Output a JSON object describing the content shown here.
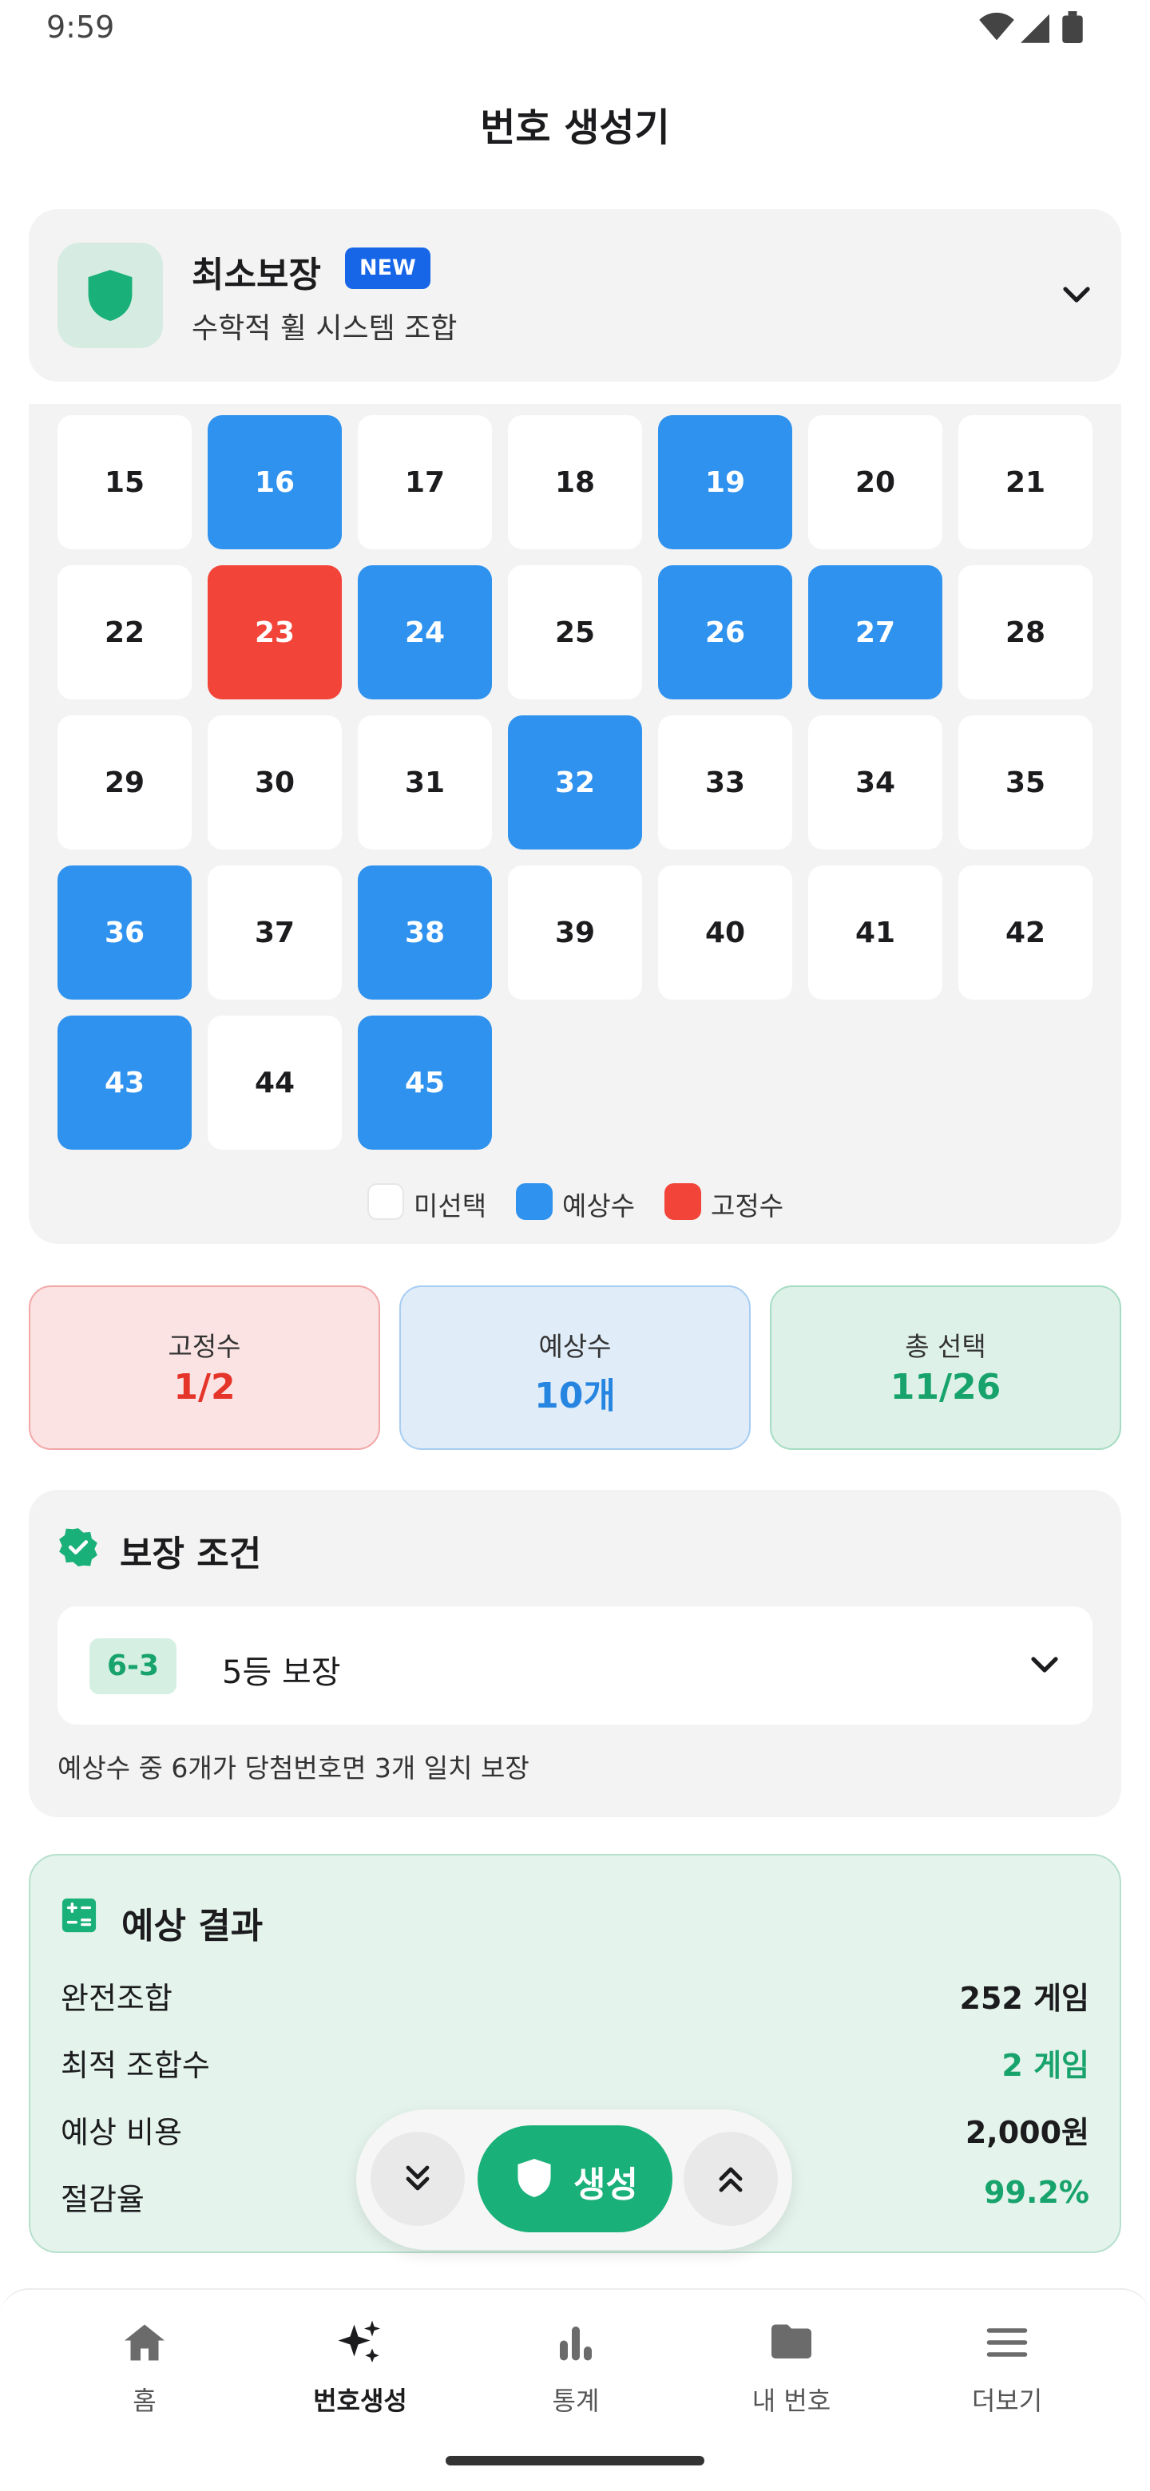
{
  "status_bar": {
    "time": "9:59"
  },
  "header": {
    "title": "번호 생성기"
  },
  "mode": {
    "name": "최소보장",
    "badge": "NEW",
    "subtitle": "수학적 휠 시스템 조합"
  },
  "grid": {
    "numbers": [
      15,
      16,
      17,
      18,
      19,
      20,
      21,
      22,
      23,
      24,
      25,
      26,
      27,
      28,
      29,
      30,
      31,
      32,
      33,
      34,
      35,
      36,
      37,
      38,
      39,
      40,
      41,
      42,
      43,
      44,
      45
    ],
    "predicted": [
      16,
      19,
      24,
      26,
      27,
      32,
      36,
      38,
      43,
      45
    ],
    "fixed": [
      23
    ]
  },
  "legend": [
    {
      "label": "미선택",
      "color": "#ffffff"
    },
    {
      "label": "예상수",
      "color": "#2f92ee"
    },
    {
      "label": "고정수",
      "color": "#f24438"
    }
  ],
  "stats": {
    "fixed": {
      "label": "고정수",
      "value": "1/2"
    },
    "predicted": {
      "label": "예상수",
      "value": "10개"
    },
    "total": {
      "label": "총 선택",
      "value": "11/26"
    }
  },
  "guarantee": {
    "title": "보장 조건",
    "code": "6-3",
    "label": "5등 보장",
    "description": "예상수 중 6개가 당첨번호면 3개 일치 보장"
  },
  "result": {
    "title": "예상 결과",
    "rows": [
      {
        "label": "완전조합",
        "value": "252 게임",
        "color": "#1c1c1e"
      },
      {
        "label": "최적 조합수",
        "value": "2 게임",
        "color": "#17a36b"
      },
      {
        "label": "예상 비용",
        "value": "2,000원",
        "color": "#1c1c1e"
      },
      {
        "label": "절감율",
        "value": "99.2%",
        "color": "#17a36b"
      }
    ]
  },
  "fab": {
    "generate_label": "생성"
  },
  "nav": {
    "items": [
      {
        "label": "홈",
        "icon": "home-icon"
      },
      {
        "label": "번호생성",
        "icon": "sparkle-icon"
      },
      {
        "label": "통계",
        "icon": "bar-chart-icon"
      },
      {
        "label": "내 번호",
        "icon": "folder-icon"
      },
      {
        "label": "더보기",
        "icon": "menu-icon"
      }
    ],
    "active_index": 1
  },
  "colors": {
    "accent": "#19b07a",
    "predicted": "#2f92ee",
    "fixed": "#f24438",
    "badge": "#1766e8"
  }
}
